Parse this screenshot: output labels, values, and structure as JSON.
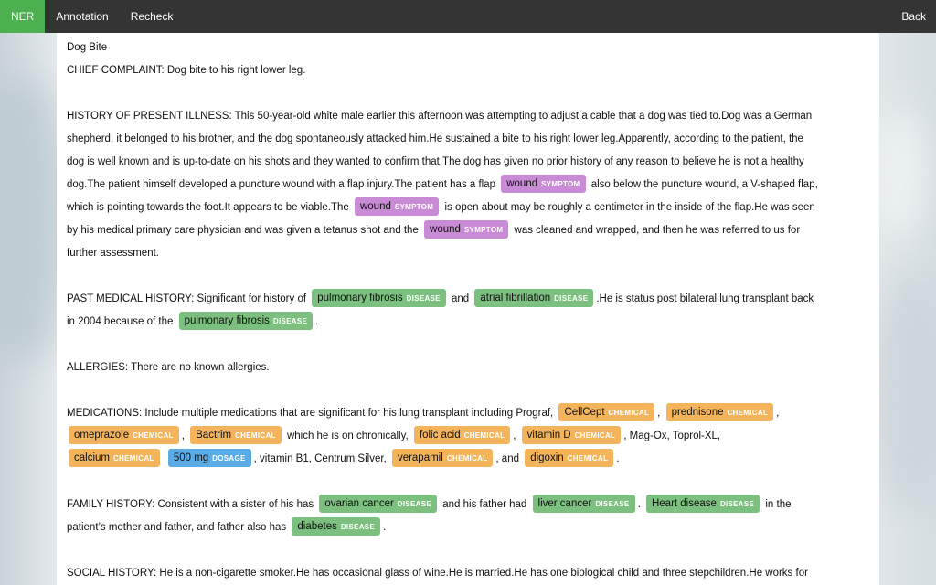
{
  "nav": {
    "active": "NER",
    "items": [
      "Annotation",
      "Recheck"
    ],
    "back": "Back"
  },
  "labels": {
    "symptom": "SYMPTOM",
    "disease": "DISEASE",
    "chemical": "CHEMICAL",
    "dosage": "DOSAGE"
  },
  "colors": {
    "nav_bg": "#343434",
    "active_tab": "#4caf50",
    "symptom": "#c98bd6",
    "disease": "#7cc07f",
    "chemical": "#f3b45b",
    "dosage": "#5aabe6"
  },
  "doc": {
    "title": "Dog Bite",
    "chief": "CHIEF COMPLAINT: Dog bite to his right lower leg.",
    "hpi": {
      "l1": "HISTORY OF PRESENT ILLNESS: This 50-year-old white male earlier this afternoon was attempting to adjust a cable that a dog was tied to.Dog was a German",
      "l2": "shepherd, it belonged to his brother, and the dog spontaneously attacked him.He sustained a bite to his right lower leg.Apparently, according to the patient, the",
      "l3": "dog is well known and is up-to-date on his shots and they wanted to confirm that.The dog has given no prior history of any reason to believe he is not a healthy",
      "l4a": "dog.The patient himself developed a puncture wound with a flap injury.The patient has a flap",
      "l4e": "wound",
      "l4b": "also below the puncture wound, a V-shaped flap,",
      "l5a": "which is pointing towards the foot.It appears to be viable.The",
      "l5e": "wound",
      "l5b": "is open about may be roughly a centimeter in the inside of the flap.He was seen",
      "l6a": "by his medical primary care physician and was given a tetanus shot and the",
      "l6e": "wound",
      "l6b": "was cleaned and wrapped, and then he was referred to us for",
      "l7": "further assessment."
    },
    "pmh": {
      "l1a": "PAST MEDICAL HISTORY: Significant for history of",
      "e1": "pulmonary fibrosis",
      "l1b": "and",
      "e2": "atrial fibrillation",
      "l1c": ".He is status post bilateral lung transplant back",
      "l2a": "in 2004 because of the",
      "e3": "pulmonary fibrosis",
      "l2b": "."
    },
    "allergies": "ALLERGIES: There are no known allergies.",
    "meds": {
      "l1a": "MEDICATIONS: Include multiple medications that are significant for his lung transplant including Prograf,",
      "e_cellcept": "CellCept",
      "c1": ",",
      "e_prednisone": "prednisone",
      "c2": ",",
      "e_omeprazole": "omeprazole",
      "c3": ",",
      "e_bactrim": "Bactrim",
      "t1": "which he is on chronically,",
      "e_folic": "folic acid",
      "c4": ",",
      "e_vitd": "vitamin D",
      "t2": ", Mag-Ox, Toprol-XL,",
      "e_calcium": "calcium",
      "e_500": "500 mg",
      "t3": ", vitamin B1, Centrum Silver,",
      "e_verapamil": "verapamil",
      "t4": ", and",
      "e_digoxin": "digoxin",
      "t5": "."
    },
    "family": {
      "l1a": "FAMILY HISTORY: Consistent with a sister of his has",
      "e1": "ovarian cancer",
      "l1b": "and his father had",
      "e2": "liver cancer",
      "l1c": ".",
      "e3": "Heart disease",
      "l1d": "in the",
      "l2a": "patient’s mother and father, and father also has",
      "e4": "diabetes",
      "l2b": "."
    },
    "social": "SOCIAL HISTORY: He is a non-cigarette smoker.He has occasional glass of wine.He is married.He has one biological child and three stepchildren.He works for"
  }
}
